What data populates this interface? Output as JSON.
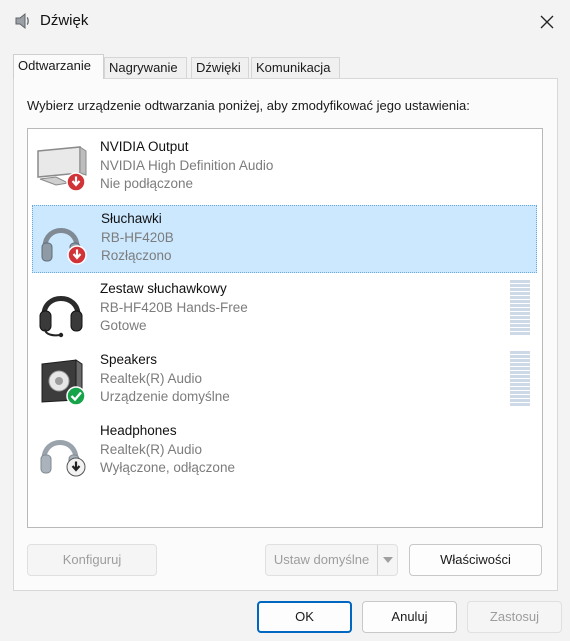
{
  "window": {
    "title": "Dźwięk"
  },
  "tabs": [
    {
      "label": "Odtwarzanie",
      "active": true
    },
    {
      "label": "Nagrywanie",
      "active": false
    },
    {
      "label": "Dźwięki",
      "active": false
    },
    {
      "label": "Komunikacja",
      "active": false
    }
  ],
  "panel": {
    "instruction": "Wybierz urządzenie odtwarzania poniżej, aby zmodyfikować jego ustawienia:"
  },
  "devices": [
    {
      "name": "NVIDIA Output",
      "driver": "NVIDIA High Definition Audio",
      "status": "Nie podłączone",
      "icon": "monitor-icon",
      "badge": "red-down-arrow",
      "selected": false
    },
    {
      "name": "Słuchawki",
      "driver": "RB-HF420B",
      "status": "Rozłączono",
      "icon": "headphones-icon",
      "badge": "red-down-arrow",
      "selected": true
    },
    {
      "name": "Zestaw słuchawkowy",
      "driver": "RB-HF420B Hands-Free",
      "status": "Gotowe",
      "icon": "headset-icon",
      "badge": "none",
      "selected": false
    },
    {
      "name": "Speakers",
      "driver": "Realtek(R) Audio",
      "status": "Urządzenie domyślne",
      "icon": "speaker-icon",
      "badge": "green-check",
      "selected": false
    },
    {
      "name": "Headphones",
      "driver": "Realtek(R) Audio",
      "status": "Wyłączone, odłączone",
      "icon": "headphones-icon",
      "badge": "black-down-arrow",
      "selected": false
    }
  ],
  "buttons": {
    "configure": "Konfiguruj",
    "set_default": "Ustaw domyślne",
    "properties": "Właściwości",
    "ok": "OK",
    "cancel": "Anuluj",
    "apply": "Zastosuj"
  },
  "colors": {
    "selection": "#cce8ff",
    "accent": "#0067c0",
    "badge_red": "#d13438",
    "badge_green": "#16a34a"
  }
}
